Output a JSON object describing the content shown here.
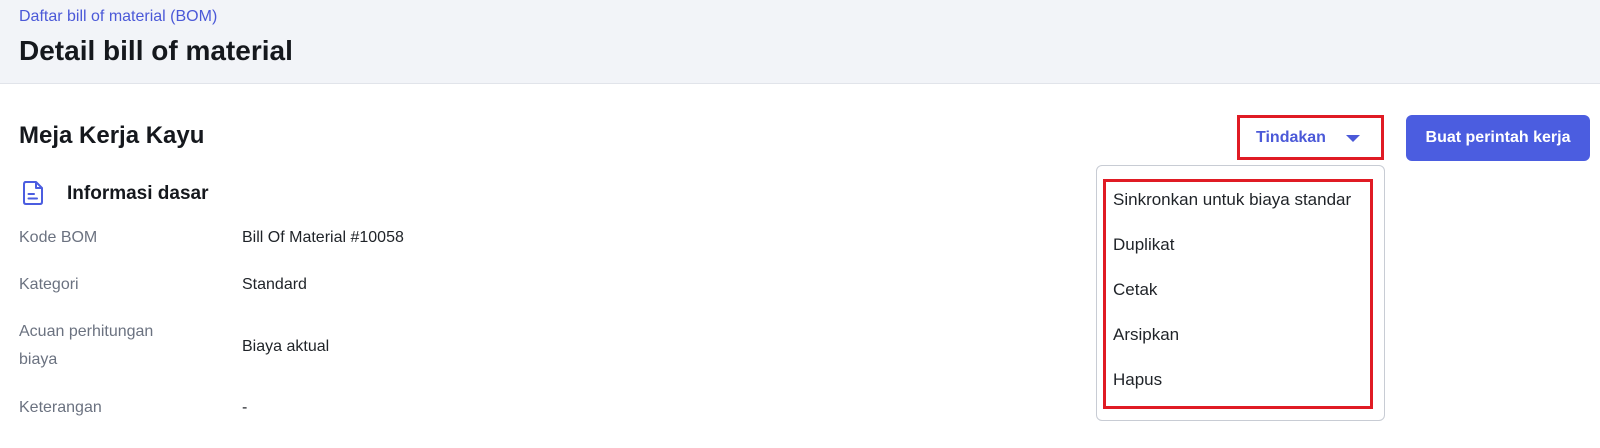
{
  "header": {
    "breadcrumb": "Daftar bill of material (BOM)",
    "title": "Detail bill of material"
  },
  "record": {
    "title": "Meja Kerja Kayu"
  },
  "section": {
    "icon": "document-icon",
    "title": "Informasi dasar",
    "fields": [
      {
        "label": "Kode BOM",
        "value": "Bill Of Material #10058"
      },
      {
        "label": "Kategori",
        "value": "Standard"
      },
      {
        "label_line1": "Acuan perhitungan",
        "label_line2": "biaya",
        "value": "Biaya aktual"
      },
      {
        "label": "Keterangan",
        "value": "-"
      }
    ]
  },
  "toolbar": {
    "actions_label": "Tindakan",
    "actions_icon": "caret-down-icon",
    "primary_label": "Buat perintah kerja"
  },
  "actions_menu": {
    "items": [
      "Sinkronkan untuk biaya standar",
      "Duplikat",
      "Cetak",
      "Arsipkan",
      "Hapus"
    ]
  },
  "colors": {
    "accent": "#4b5de0",
    "highlight": "#e01b24",
    "header_bg": "#f2f4f8"
  }
}
